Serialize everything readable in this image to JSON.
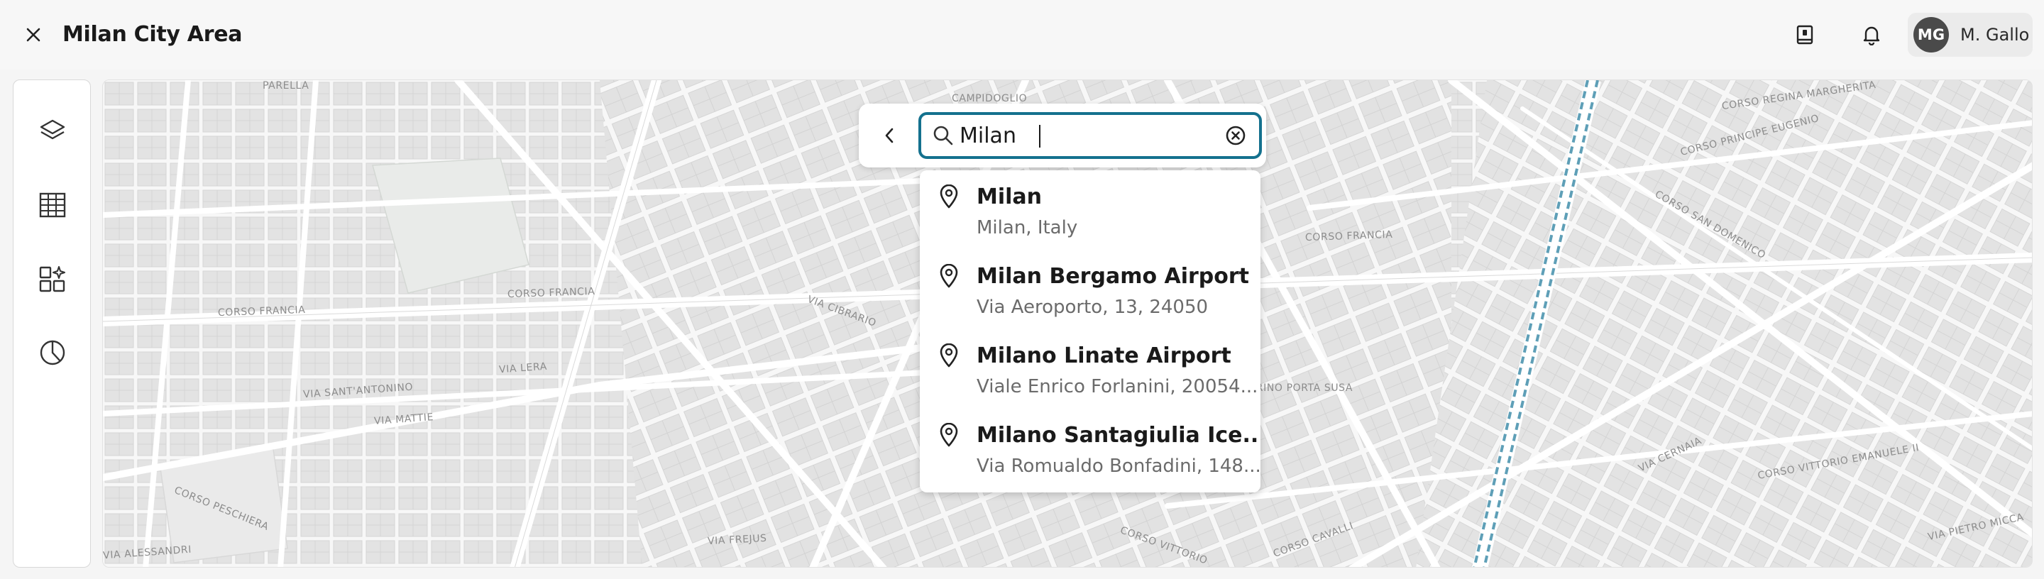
{
  "header": {
    "title": "Milan City Area",
    "close_icon": "close-icon",
    "book_icon": "book-icon",
    "bell_icon": "bell-icon",
    "user": {
      "initials": "MG",
      "name": "M. Gallo"
    }
  },
  "sidebar": {
    "items": [
      {
        "name": "layers",
        "icon": "layers-icon"
      },
      {
        "name": "table",
        "icon": "table-icon"
      },
      {
        "name": "widgets",
        "icon": "widgets-icon"
      },
      {
        "name": "analytics",
        "icon": "pie-chart-icon"
      }
    ]
  },
  "map": {
    "street_labels": [
      "Parella",
      "Corso Francia",
      "Corso Francia",
      "Corso Francia",
      "Via Sant'Antonino",
      "Via Mattie",
      "Via Lera",
      "Via Frejus",
      "Via Alessandri",
      "Corso Peschiera",
      "Corso Vittorio",
      "Corso Cavalli",
      "Campidoglio",
      "Corso Principe Eugenio",
      "Corso San Domenico",
      "Via Pietro Micca",
      "Corso Regina Margherita",
      "Corso Vittorio Emanuele II",
      "Via Cernaia",
      "Torino Porta Susa",
      "Via Cibrario"
    ],
    "rail_color": "#5e9fb7"
  },
  "search": {
    "back_icon": "chevron-left-icon",
    "query": "Milan",
    "clear_icon": "clear-circle-icon",
    "accent": "#14718e"
  },
  "results": [
    {
      "name": "Milan",
      "address": "Milan, Italy"
    },
    {
      "name": "Milan Bergamo Airport",
      "address": "Via Aeroporto, 13, 24050"
    },
    {
      "name": "Milano Linate Airport",
      "address": "Viale Enrico Forlanini, 20054..."
    },
    {
      "name": "Milano Santagiulia Ice...",
      "address": "Via Romualdo Bonfadini, 148..."
    }
  ]
}
